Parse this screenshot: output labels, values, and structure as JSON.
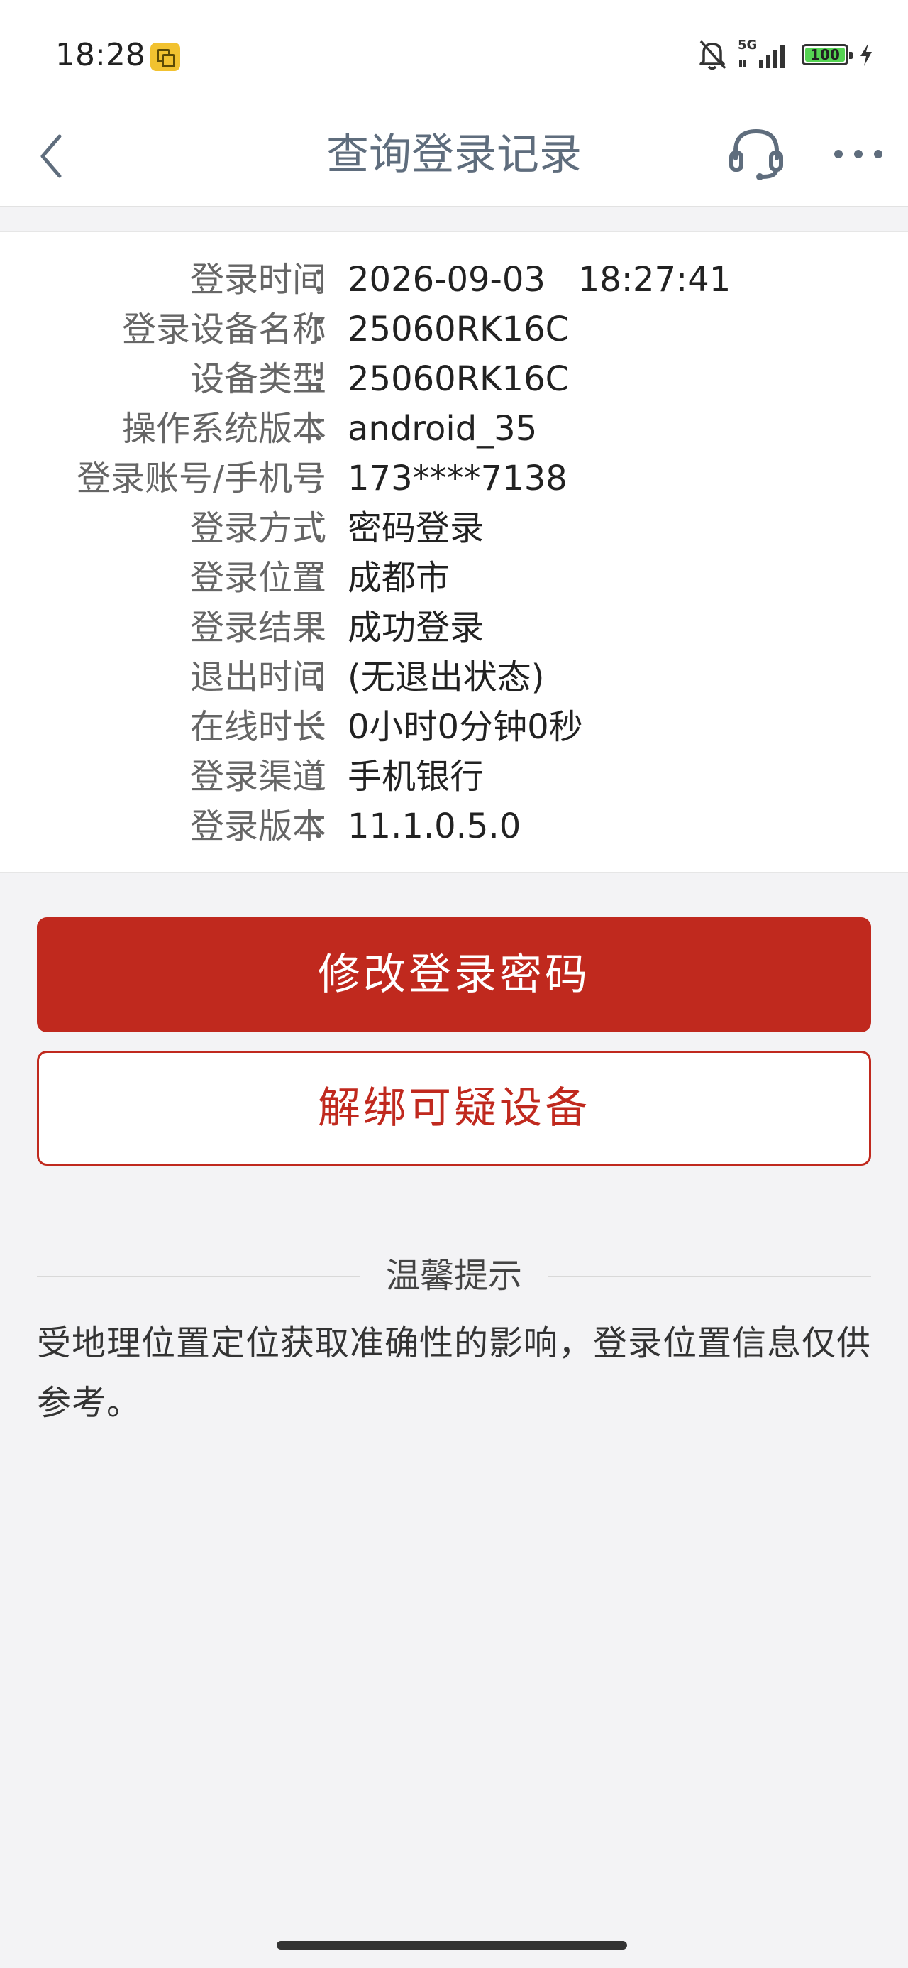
{
  "status_bar": {
    "time": "18:28",
    "network": "5G",
    "battery": "100"
  },
  "nav": {
    "title": "查询登录记录",
    "back_icon": "chevron-left-icon",
    "service_icon": "headset-icon",
    "more_icon": "more-dots-icon"
  },
  "colon": "：",
  "rows": [
    {
      "label": "登录时间",
      "value": "2026-09-03   18:27:41"
    },
    {
      "label": "登录设备名称",
      "value": "25060RK16C"
    },
    {
      "label": "设备类型",
      "value": "25060RK16C"
    },
    {
      "label": "操作系统版本",
      "value": "android_35"
    },
    {
      "label": "登录账号/手机号",
      "value": "173****7138"
    },
    {
      "label": "登录方式",
      "value": "密码登录"
    },
    {
      "label": "登录位置",
      "value": "成都市"
    },
    {
      "label": "登录结果",
      "value": "成功登录"
    },
    {
      "label": "退出时间",
      "value": "(无退出状态)"
    },
    {
      "label": "在线时长",
      "value": "0小时0分钟0秒"
    },
    {
      "label": "登录渠道",
      "value": "手机银行"
    },
    {
      "label": "登录版本",
      "value": "11.1.0.5.0"
    }
  ],
  "buttons": {
    "change_password": "修改登录密码",
    "unbind_device": "解绑可疑设备"
  },
  "tips": {
    "title": "温馨提示",
    "text": "受地理位置定位获取准确性的影响，登录位置信息仅供参考。"
  },
  "colors": {
    "accent": "#c0291e",
    "nav_title": "#5f6d7d",
    "background": "#f3f3f5",
    "battery_fill": "#55d452"
  }
}
